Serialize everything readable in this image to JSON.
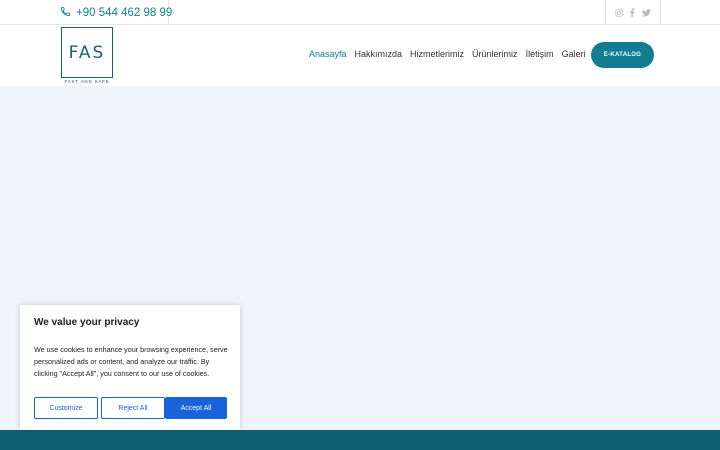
{
  "topbar": {
    "phone": "+90 544 462 98 99",
    "social_icons": [
      "instagram-icon",
      "facebook-icon",
      "twitter-icon"
    ]
  },
  "logo": {
    "letters": "FAS",
    "tagline": "FAST AND SAFE"
  },
  "nav": {
    "items": [
      {
        "label": "Anasayfa",
        "active": true
      },
      {
        "label": "Hakkımızda",
        "active": false
      },
      {
        "label": "Hizmetlerimiz",
        "active": false
      },
      {
        "label": "Ürünlerimiz",
        "active": false
      },
      {
        "label": "İletişim",
        "active": false
      },
      {
        "label": "Galeri",
        "active": false
      }
    ],
    "cta_label": "E-KATALOG"
  },
  "cookie": {
    "title": "We value your privacy",
    "text": "We use cookies to enhance your browsing experience, serve personalized ads or content, and analyze our traffic. By clicking \"Accept All\", you consent to our use of cookies.",
    "customize_label": "Customize",
    "reject_label": "Reject All",
    "accept_label": "Accept All"
  },
  "colors": {
    "accent": "#127d92",
    "brand_dark": "#14627a",
    "hero_bg": "#eef5fa",
    "footer": "#0f5f73",
    "cookie_button": "#1863dc"
  }
}
